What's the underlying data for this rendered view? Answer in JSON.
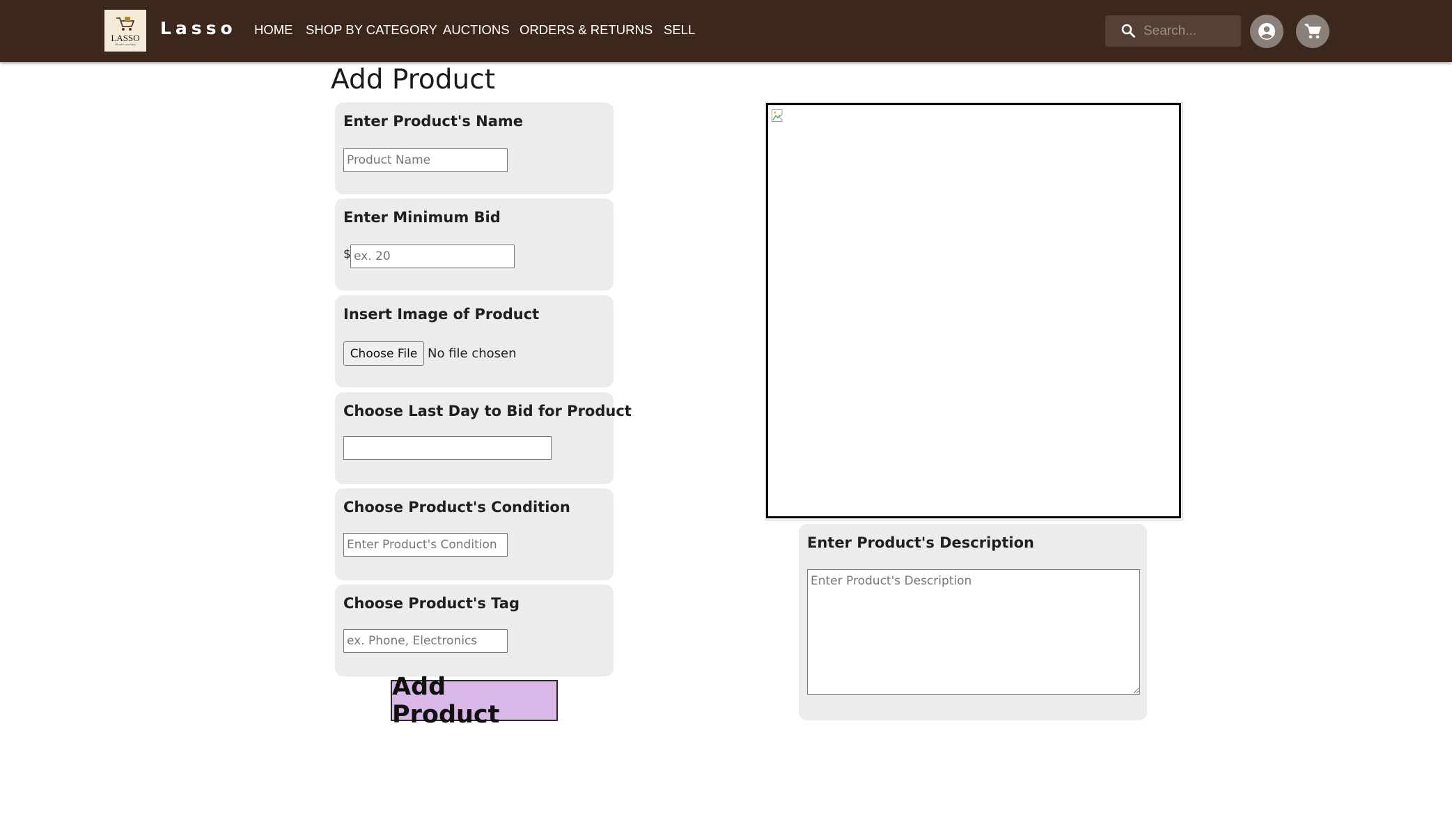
{
  "navbar": {
    "logo": {
      "text": "LASSO",
      "tagline": "We take your bags"
    },
    "brand": "Lasso",
    "links": [
      "HOME",
      "SHOP BY CATEGORY",
      "AUCTIONS",
      "ORDERS & RETURNS",
      "SELL"
    ],
    "search": {
      "placeholder": "Search...",
      "icon": "search-icon"
    },
    "account_icon": "account-circle-icon",
    "cart_icon": "shopping-cart-icon"
  },
  "page": {
    "title": "Add Product"
  },
  "form": {
    "name": {
      "label": "Enter Product's Name",
      "placeholder": "Product Name",
      "value": ""
    },
    "bid": {
      "label": "Enter Minimum Bid",
      "currency": "$",
      "placeholder": "ex. 20",
      "value": ""
    },
    "image": {
      "label": "Insert Image of Product",
      "button": "Choose File",
      "status": "No file chosen"
    },
    "date": {
      "label": "Choose Last Day to Bid for Product",
      "value": ""
    },
    "condition": {
      "label": "Choose Product's Condition",
      "placeholder": "Enter Product's Condition",
      "value": ""
    },
    "tag": {
      "label": "Choose Product's Tag",
      "placeholder": "ex. Phone, Electronics",
      "value": ""
    },
    "submit": "Add Product"
  },
  "description": {
    "label": "Enter Product's Description",
    "placeholder": "Enter Product's Description",
    "value": ""
  },
  "colors": {
    "navbar": "#3b271b",
    "card": "#ececec",
    "submit": "#d9b8e8"
  }
}
